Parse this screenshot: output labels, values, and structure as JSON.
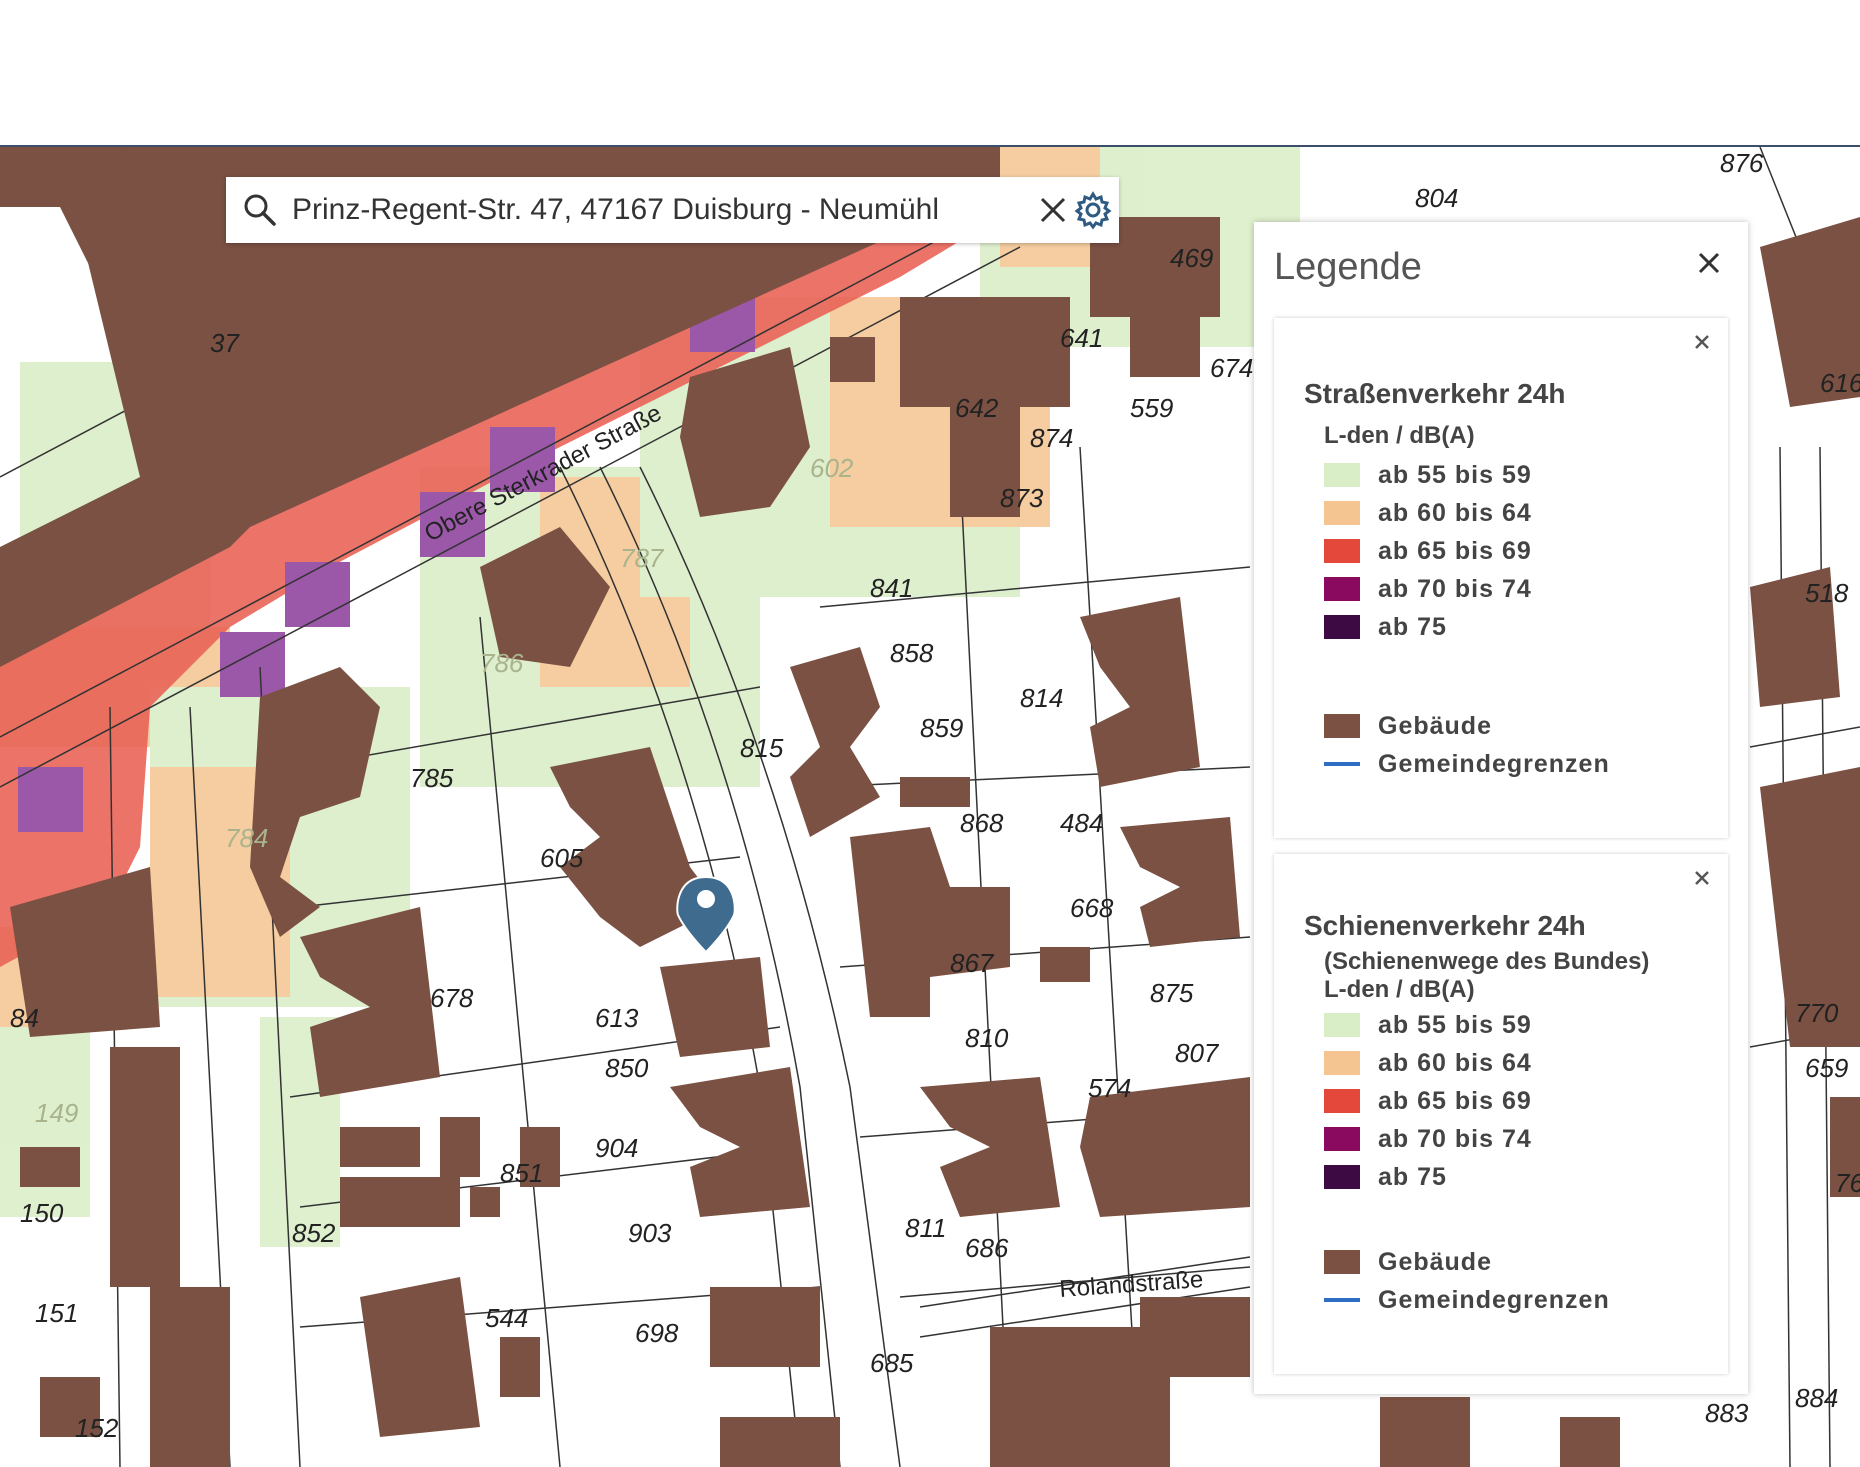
{
  "search": {
    "value": "Prinz-Regent-Str. 47, 47167 Duisburg - Neumühl",
    "icon": "search-icon",
    "clear_icon": "close-icon",
    "settings_icon": "gear-icon"
  },
  "legend": {
    "title": "Legende",
    "close_icon": "close-icon",
    "cards": [
      {
        "title": "Straßenverkehr 24h",
        "subtitle": "",
        "unit": "L-den / dB(A)",
        "classes": [
          {
            "label": "ab 55 bis 59",
            "color": "#d9edc6"
          },
          {
            "label": "ab 60 bis 64",
            "color": "#f4c590"
          },
          {
            "label": "ab 65 bis 69",
            "color": "#e4483a"
          },
          {
            "label": "ab 70 bis 74",
            "color": "#8a0a5f"
          },
          {
            "label": "ab 75",
            "color": "#3d0a44"
          }
        ],
        "layers": [
          {
            "label": "Gebäude",
            "color": "#7a5142"
          },
          {
            "label": "Gemeindegrenzen",
            "color": "#2e6fc4"
          }
        ]
      },
      {
        "title": "Schienenverkehr 24h",
        "subtitle": "(Schienenwege des Bundes)",
        "unit": "L-den / dB(A)",
        "classes": [
          {
            "label": "ab 55 bis 59",
            "color": "#d9edc6"
          },
          {
            "label": "ab 60 bis 64",
            "color": "#f4c590"
          },
          {
            "label": "ab 65 bis 69",
            "color": "#e4483a"
          },
          {
            "label": "ab 70 bis 74",
            "color": "#8a0a5f"
          },
          {
            "label": "ab 75",
            "color": "#3d0a44"
          }
        ],
        "layers": [
          {
            "label": "Gebäude",
            "color": "#7a5142"
          },
          {
            "label": "Gemeindegrenzen",
            "color": "#2e6fc4"
          }
        ]
      }
    ]
  },
  "map": {
    "streets": [
      "Obere Sterkrader Straße",
      "Rolandstraße"
    ],
    "plots": [
      "37",
      "469",
      "642",
      "641",
      "674",
      "559",
      "874",
      "873",
      "602",
      "787",
      "841",
      "858",
      "786",
      "814",
      "859",
      "815",
      "785",
      "605",
      "868",
      "484",
      "784",
      "668",
      "678",
      "867",
      "875",
      "613",
      "810",
      "807",
      "850",
      "574",
      "904",
      "851",
      "150",
      "852",
      "903",
      "811",
      "686",
      "151",
      "544",
      "698",
      "685",
      "152",
      "876",
      "804",
      "616",
      "518",
      "770",
      "659",
      "884",
      "883",
      "149",
      "84",
      "76"
    ],
    "marker_icon": "map-pin-icon"
  }
}
